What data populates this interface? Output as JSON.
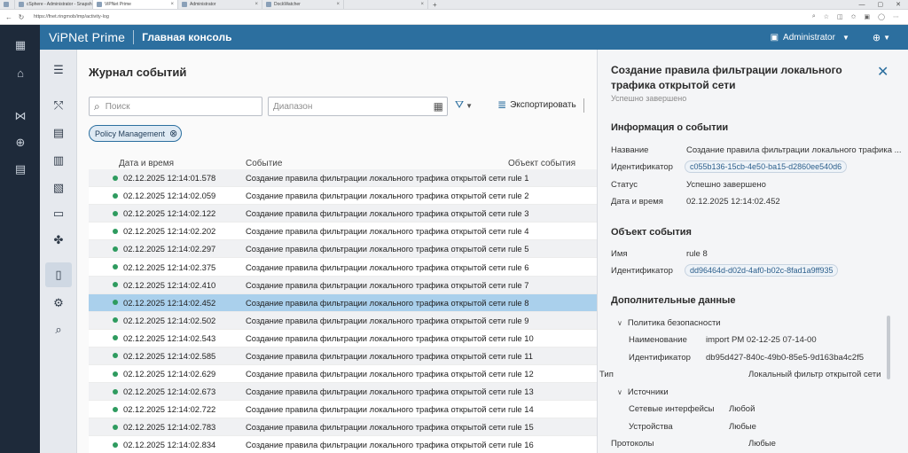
{
  "browser": {
    "tabs": [
      {
        "label": ""
      },
      {
        "label": "cSphere - Administrator - Snapsh"
      },
      {
        "label": "ViPNet Prime"
      },
      {
        "label": "Administrator"
      },
      {
        "label": "DockWatcher"
      },
      {
        "label": ""
      }
    ],
    "url": "https://fnet.ringmob/imp/activity-log"
  },
  "header": {
    "brand": "ViPNet Prime",
    "console": "Главная консоль",
    "user": "Administrator"
  },
  "main": {
    "title": "Журнал событий",
    "search_placeholder": "Поиск",
    "range_placeholder": "Диапазон",
    "export_label": "Экспортировать",
    "chip_label": "Policy Management",
    "columns": {
      "date": "Дата и время",
      "event": "Событие",
      "object": "Объект события"
    },
    "rows": [
      {
        "date": "02.12.2025 12:14:01.578",
        "event": "Создание правила фильтрации локального трафика открытой сети",
        "object": "rule 1"
      },
      {
        "date": "02.12.2025 12:14:02.059",
        "event": "Создание правила фильтрации локального трафика открытой сети",
        "object": "rule 2"
      },
      {
        "date": "02.12.2025 12:14:02.122",
        "event": "Создание правила фильтрации локального трафика открытой сети",
        "object": "rule 3"
      },
      {
        "date": "02.12.2025 12:14:02.202",
        "event": "Создание правила фильтрации локального трафика открытой сети",
        "object": "rule 4"
      },
      {
        "date": "02.12.2025 12:14:02.297",
        "event": "Создание правила фильтрации локального трафика открытой сети",
        "object": "rule 5"
      },
      {
        "date": "02.12.2025 12:14:02.375",
        "event": "Создание правила фильтрации локального трафика открытой сети",
        "object": "rule 6"
      },
      {
        "date": "02.12.2025 12:14:02.410",
        "event": "Создание правила фильтрации локального трафика открытой сети",
        "object": "rule 7"
      },
      {
        "date": "02.12.2025 12:14:02.452",
        "event": "Создание правила фильтрации локального трафика открытой сети",
        "object": "rule 8"
      },
      {
        "date": "02.12.2025 12:14:02.502",
        "event": "Создание правила фильтрации локального трафика открытой сети",
        "object": "rule 9"
      },
      {
        "date": "02.12.2025 12:14:02.543",
        "event": "Создание правила фильтрации локального трафика открытой сети",
        "object": "rule 10"
      },
      {
        "date": "02.12.2025 12:14:02.585",
        "event": "Создание правила фильтрации локального трафика открытой сети",
        "object": "rule 11"
      },
      {
        "date": "02.12.2025 12:14:02.629",
        "event": "Создание правила фильтрации локального трафика открытой сети",
        "object": "rule 12"
      },
      {
        "date": "02.12.2025 12:14:02.673",
        "event": "Создание правила фильтрации локального трафика открытой сети",
        "object": "rule 13"
      },
      {
        "date": "02.12.2025 12:14:02.722",
        "event": "Создание правила фильтрации локального трафика открытой сети",
        "object": "rule 14"
      },
      {
        "date": "02.12.2025 12:14:02.783",
        "event": "Создание правила фильтрации локального трафика открытой сети",
        "object": "rule 15"
      },
      {
        "date": "02.12.2025 12:14:02.834",
        "event": "Создание правила фильтрации локального трафика открытой сети",
        "object": "rule 16"
      }
    ],
    "selected_index": 7
  },
  "detail": {
    "title": "Создание правила фильтрации локального трафика открытой сети",
    "status": "Успешно завершено",
    "info": {
      "heading": "Информация о событии",
      "name_label": "Название",
      "name_value": "Создание правила фильтрации локального трафика ...",
      "id_label": "Идентификатор",
      "id_value": "c055b136-15cb-4e50-ba15-d2860ee540d6",
      "status_label": "Статус",
      "status_value": "Успешно завершено",
      "datetime_label": "Дата и время",
      "datetime_value": "02.12.2025 12:14:02.452"
    },
    "object": {
      "heading": "Объект события",
      "name_label": "Имя",
      "name_value": "rule 8",
      "id_label": "Идентификатор",
      "id_value": "dd96464d-d02d-4af0-b02c-8fad1a9ff935"
    },
    "extra": {
      "heading": "Дополнительные данные",
      "policy_label": "Политика безопасности",
      "policy_name_label": "Наименование",
      "policy_name_value": "import PM 02-12-25 07-14-00",
      "policy_id_label": "Идентификатор",
      "policy_id_value": "db95d427-840c-49b0-85e5-9d163ba4c2f5",
      "type_label": "Тип",
      "type_value": "Локальный фильтр открытой сети",
      "sources_label": "Источники",
      "net_if_label": "Сетевые интерфейсы",
      "net_if_value": "Любой",
      "devices_label": "Устройства",
      "devices_value": "Любые",
      "protocols_label": "Протоколы",
      "protocols_value": "Любые"
    }
  },
  "colors": {
    "header": "#2c6f9f",
    "rail": "#1e2a3a",
    "selected_row": "#aad0ec",
    "status_dot": "#2e9b5f"
  }
}
